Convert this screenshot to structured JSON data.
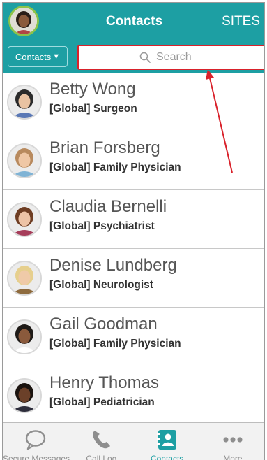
{
  "header": {
    "title": "Contacts",
    "sites_label": "SITES"
  },
  "filter": {
    "dropdown_label": "Contacts",
    "dropdown_caret": "▼"
  },
  "search": {
    "placeholder": "Search"
  },
  "contacts": [
    {
      "name": "Betty Wong",
      "role": "[Global] Surgeon",
      "hair": "#2b2b2b",
      "skin": "#e9c3a2",
      "shirt": "#5a78b5"
    },
    {
      "name": "Brian Forsberg",
      "role": "[Global] Family Physician",
      "hair": "#b88a5e",
      "skin": "#efc7a5",
      "shirt": "#7fb3d5"
    },
    {
      "name": "Claudia Bernelli",
      "role": "[Global] Psychiatrist",
      "hair": "#6e3d23",
      "skin": "#edc3a6",
      "shirt": "#a63d5a"
    },
    {
      "name": "Denise Lundberg",
      "role": "[Global] Neurologist",
      "hair": "#e6cf8d",
      "skin": "#efcaa8",
      "shirt": "#8e6b3e"
    },
    {
      "name": "Gail Goodman",
      "role": "[Global] Family Physician",
      "hair": "#1e1a17",
      "skin": "#8a5a3c",
      "shirt": "#ffffff"
    },
    {
      "name": "Henry Thomas",
      "role": "[Global] Pediatrician",
      "hair": "#1b1410",
      "skin": "#6b4029",
      "shirt": "#2d2d3b"
    }
  ],
  "tabs": [
    {
      "label": "Secure Messages",
      "icon": "chat-bubble-icon",
      "active": false
    },
    {
      "label": "Call Log",
      "icon": "phone-icon",
      "active": false
    },
    {
      "label": "Contacts",
      "icon": "contacts-book-icon",
      "active": true
    },
    {
      "label": "More",
      "icon": "more-dots-icon",
      "active": false
    }
  ],
  "colors": {
    "brand": "#1d9fa3",
    "highlight": "#d9222b"
  }
}
